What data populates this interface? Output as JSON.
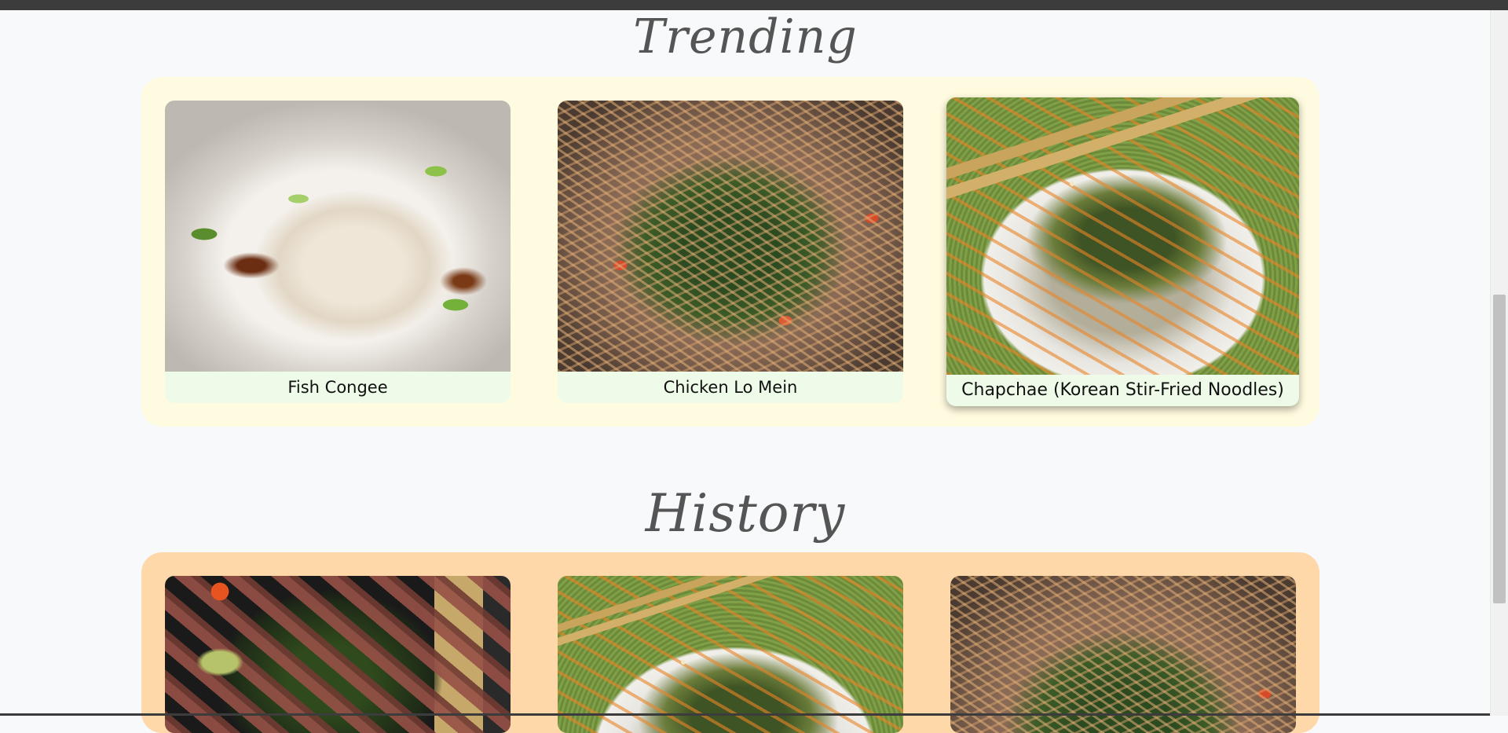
{
  "trending": {
    "title": "Trending",
    "cards": [
      {
        "name": "Fish Congee"
      },
      {
        "name": "Chicken Lo Mein"
      },
      {
        "name": "Chapchae (Korean Stir-Fried Noodles)"
      }
    ]
  },
  "history": {
    "title": "History"
  },
  "colors": {
    "page_background": "#f8f9fa",
    "trending_panel": "#fffbe0",
    "history_panel": "#ffd8aa",
    "card_caption_bg": "#eefbe8",
    "title_text": "#555555"
  }
}
